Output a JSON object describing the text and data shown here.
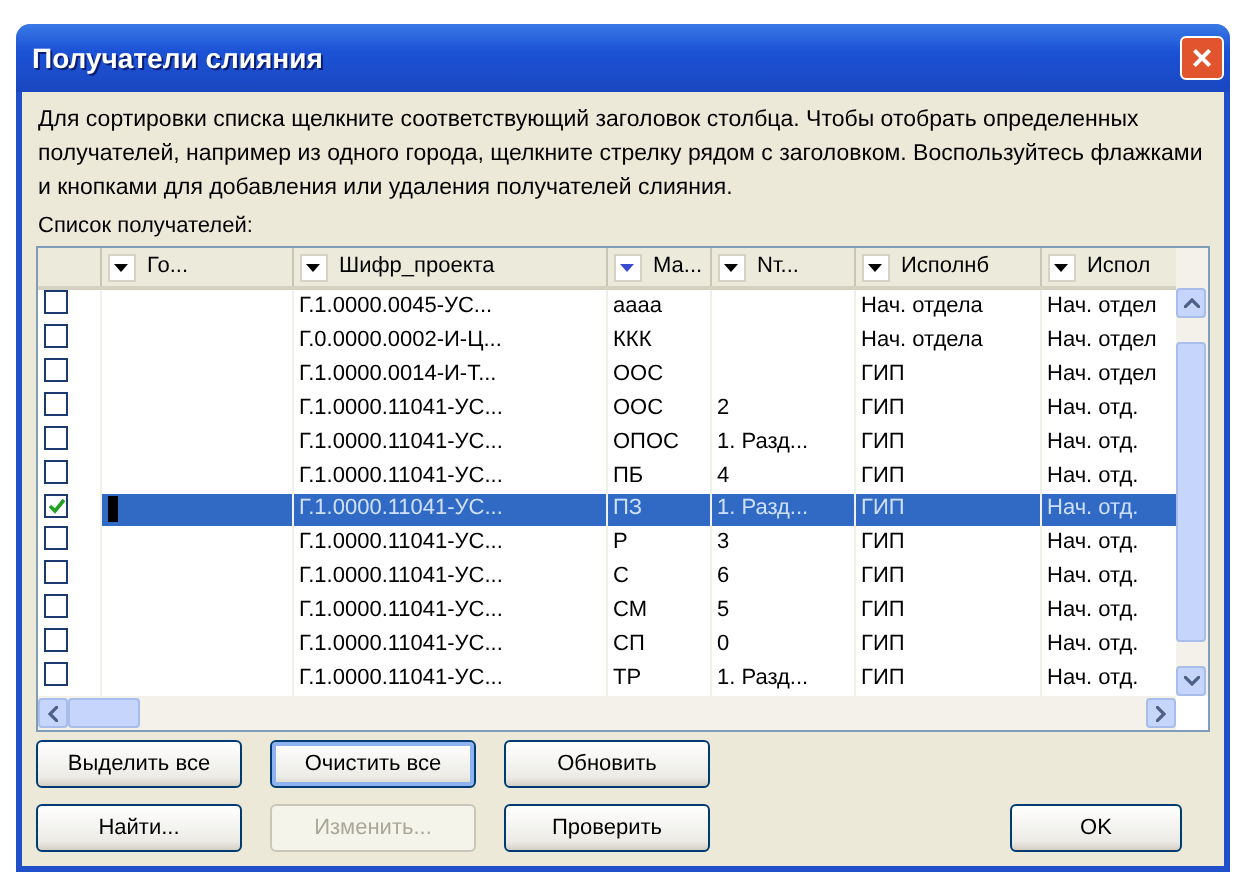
{
  "window": {
    "title": "Получатели слияния",
    "close": "×"
  },
  "instructions": "Для сортировки списка щелкните соответствующий заголовок столбца.  Чтобы отобрать определенных получателей, например из одного города, щелкните стрелку рядом с заголовком. Воспользуйтесь флажками и кнопками для добавления или удаления получателей слияния.",
  "list_label": {
    "text": "Список получателей:"
  },
  "table": {
    "columns": [
      {
        "label": "Го...",
        "filtered": false
      },
      {
        "label": "Шифр_проекта",
        "filtered": false
      },
      {
        "label": "Ма...",
        "filtered": true
      },
      {
        "label": "Nт...",
        "filtered": false
      },
      {
        "label": "Исполнб",
        "filtered": false
      },
      {
        "label": "Испол",
        "filtered": false
      }
    ],
    "rows": [
      {
        "checked": false,
        "selected": false,
        "cells": [
          "",
          "Г.1.0000.0045-УС...",
          "аааа",
          "",
          "Нач. отдела",
          "Нач. отдел"
        ]
      },
      {
        "checked": false,
        "selected": false,
        "cells": [
          "",
          "Г.0.0000.0002-И-Ц...",
          "ККК",
          "",
          "Нач. отдела",
          "Нач. отдел"
        ]
      },
      {
        "checked": false,
        "selected": false,
        "cells": [
          "",
          "Г.1.0000.0014-И-Т...",
          "ООС",
          "",
          "ГИП",
          "Нач. отдел"
        ]
      },
      {
        "checked": false,
        "selected": false,
        "cells": [
          "",
          "Г.1.0000.11041-УС...",
          "ООС",
          "2",
          "ГИП",
          "Нач. отд."
        ]
      },
      {
        "checked": false,
        "selected": false,
        "cells": [
          "",
          "Г.1.0000.11041-УС...",
          "ОПОС",
          "1. Разд...",
          "ГИП",
          "Нач. отд."
        ]
      },
      {
        "checked": false,
        "selected": false,
        "cells": [
          "",
          "Г.1.0000.11041-УС...",
          "ПБ",
          "4",
          "ГИП",
          "Нач. отд."
        ]
      },
      {
        "checked": true,
        "selected": true,
        "cells": [
          "",
          "Г.1.0000.11041-УС...",
          "ПЗ",
          "1. Разд...",
          "ГИП",
          "Нач. отд."
        ]
      },
      {
        "checked": false,
        "selected": false,
        "cells": [
          "",
          "Г.1.0000.11041-УС...",
          "Р",
          "3",
          "ГИП",
          "Нач. отд."
        ]
      },
      {
        "checked": false,
        "selected": false,
        "cells": [
          "",
          "Г.1.0000.11041-УС...",
          "С",
          "6",
          "ГИП",
          "Нач. отд."
        ]
      },
      {
        "checked": false,
        "selected": false,
        "cells": [
          "",
          "Г.1.0000.11041-УС...",
          "СМ",
          "5",
          "ГИП",
          "Нач. отд."
        ]
      },
      {
        "checked": false,
        "selected": false,
        "cells": [
          "",
          "Г.1.0000.11041-УС...",
          "СП",
          "0",
          "ГИП",
          "Нач. отд."
        ]
      },
      {
        "checked": false,
        "selected": false,
        "cells": [
          "",
          "Г.1.0000.11041-УС...",
          "ТР",
          "1. Разд...",
          "ГИП",
          "Нач. отд."
        ]
      }
    ]
  },
  "buttons": [
    [
      {
        "label": "Выделить все",
        "disabled": false,
        "focused": false
      },
      {
        "label": "Очистить все",
        "disabled": false,
        "focused": true
      },
      {
        "label": "Обновить",
        "disabled": false,
        "focused": false
      }
    ],
    [
      {
        "label": "Найти...",
        "disabled": false,
        "focused": false
      },
      {
        "label": "Изменить...",
        "disabled": true,
        "focused": false
      },
      {
        "label": "Проверить",
        "disabled": false,
        "focused": false
      }
    ]
  ],
  "ok_button": {
    "label": "OK"
  }
}
